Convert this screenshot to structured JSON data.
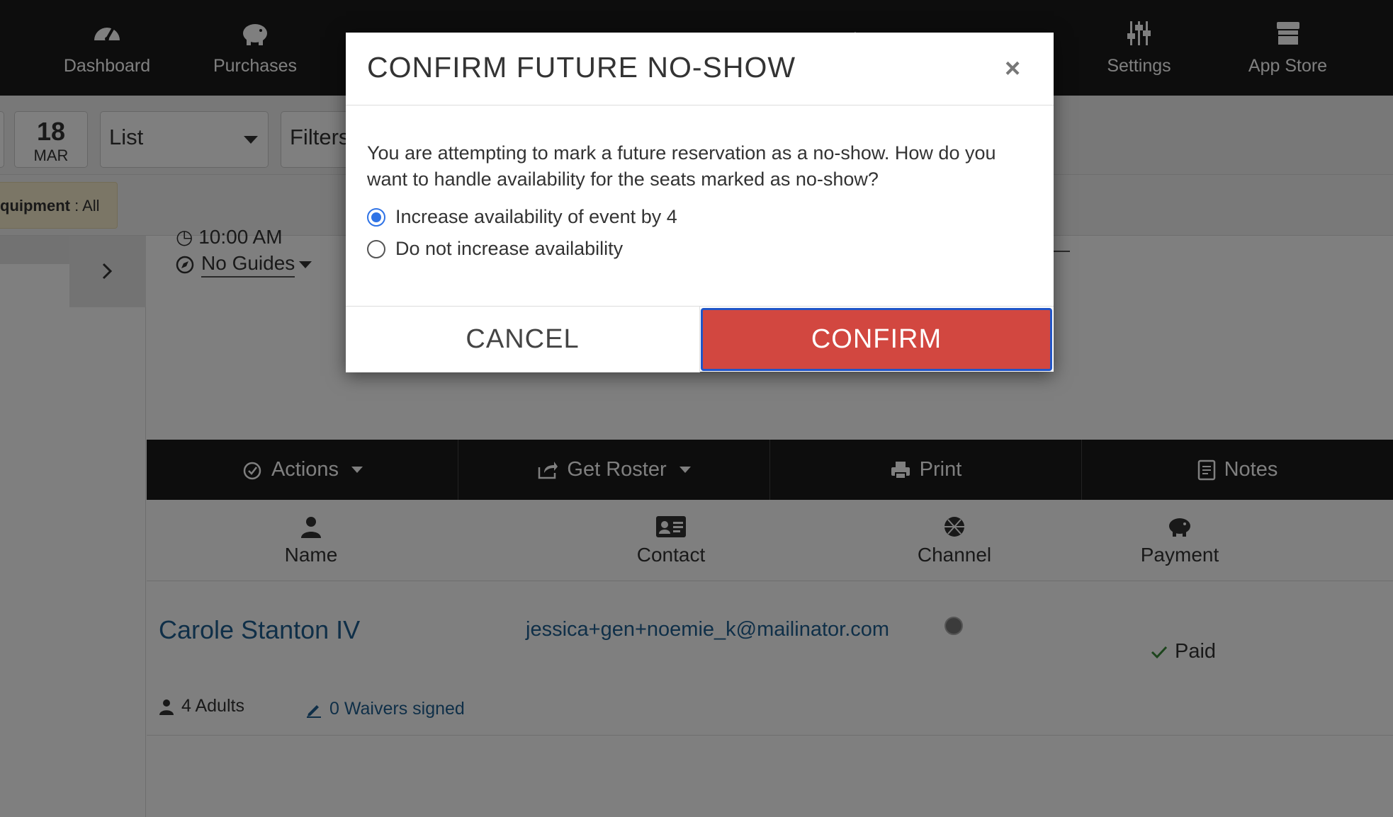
{
  "nav": {
    "items": [
      {
        "label": "Dashboard",
        "icon": "speedometer-icon"
      },
      {
        "label": "Purchases",
        "icon": "piggy-bank-icon"
      },
      {
        "label": "",
        "icon": "people-icon"
      },
      {
        "label": "",
        "icon": "register-icon"
      },
      {
        "label": "",
        "icon": "clipboard-icon"
      },
      {
        "label": "",
        "icon": "chart-icon"
      },
      {
        "label": "",
        "icon": "megaphone-icon"
      },
      {
        "label": "Settings",
        "icon": "sliders-icon"
      },
      {
        "label": "App Store",
        "icon": "store-icon"
      }
    ]
  },
  "toolbar": {
    "date_day": "18",
    "date_month": "MAR",
    "view_select": "List",
    "filters_label": "Filters"
  },
  "filterbar": {
    "equipment_label": "quipment",
    "equipment_value": " : All"
  },
  "event": {
    "time": "10:00 AM",
    "guides": "No Guides"
  },
  "actions": {
    "actions_label": "Actions",
    "roster_label": "Get Roster",
    "print_label": "Print",
    "notes_label": "Notes"
  },
  "columns": {
    "name": "Name",
    "contact": "Contact",
    "channel": "Channel",
    "payment": "Payment"
  },
  "reservation": {
    "name": "Carole Stanton IV",
    "email": "jessica+gen+noemie_k@mailinator.com",
    "payment_status": "Paid",
    "guests": "4 Adults",
    "waivers": "0 Waivers signed"
  },
  "modal": {
    "title": "CONFIRM FUTURE NO-SHOW",
    "close": "×",
    "body": "You are attempting to mark a future reservation as a no-show. How do you want to handle availability for the seats marked as no-show?",
    "option_increase": "Increase availability of event by 4",
    "option_no_increase": "Do not increase availability",
    "selected_option": "increase",
    "cancel_label": "CANCEL",
    "confirm_label": "CONFIRM"
  },
  "colors": {
    "nav_bg": "#1a1a1a",
    "confirm_bg": "#d24740",
    "link": "#1f5f91",
    "radio_selected": "#2f73e6"
  }
}
